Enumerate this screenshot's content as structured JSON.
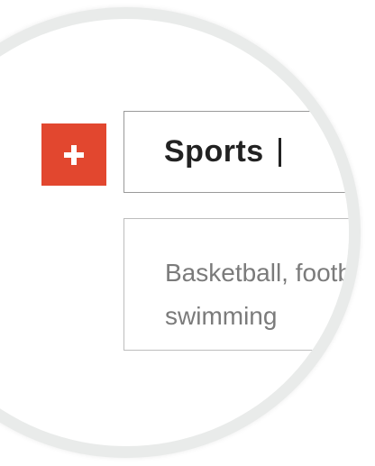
{
  "category": {
    "add_icon": "plus-icon",
    "add_color": "#e2472f",
    "title": "Sports",
    "description": "Basketball, football,\nswimming"
  }
}
